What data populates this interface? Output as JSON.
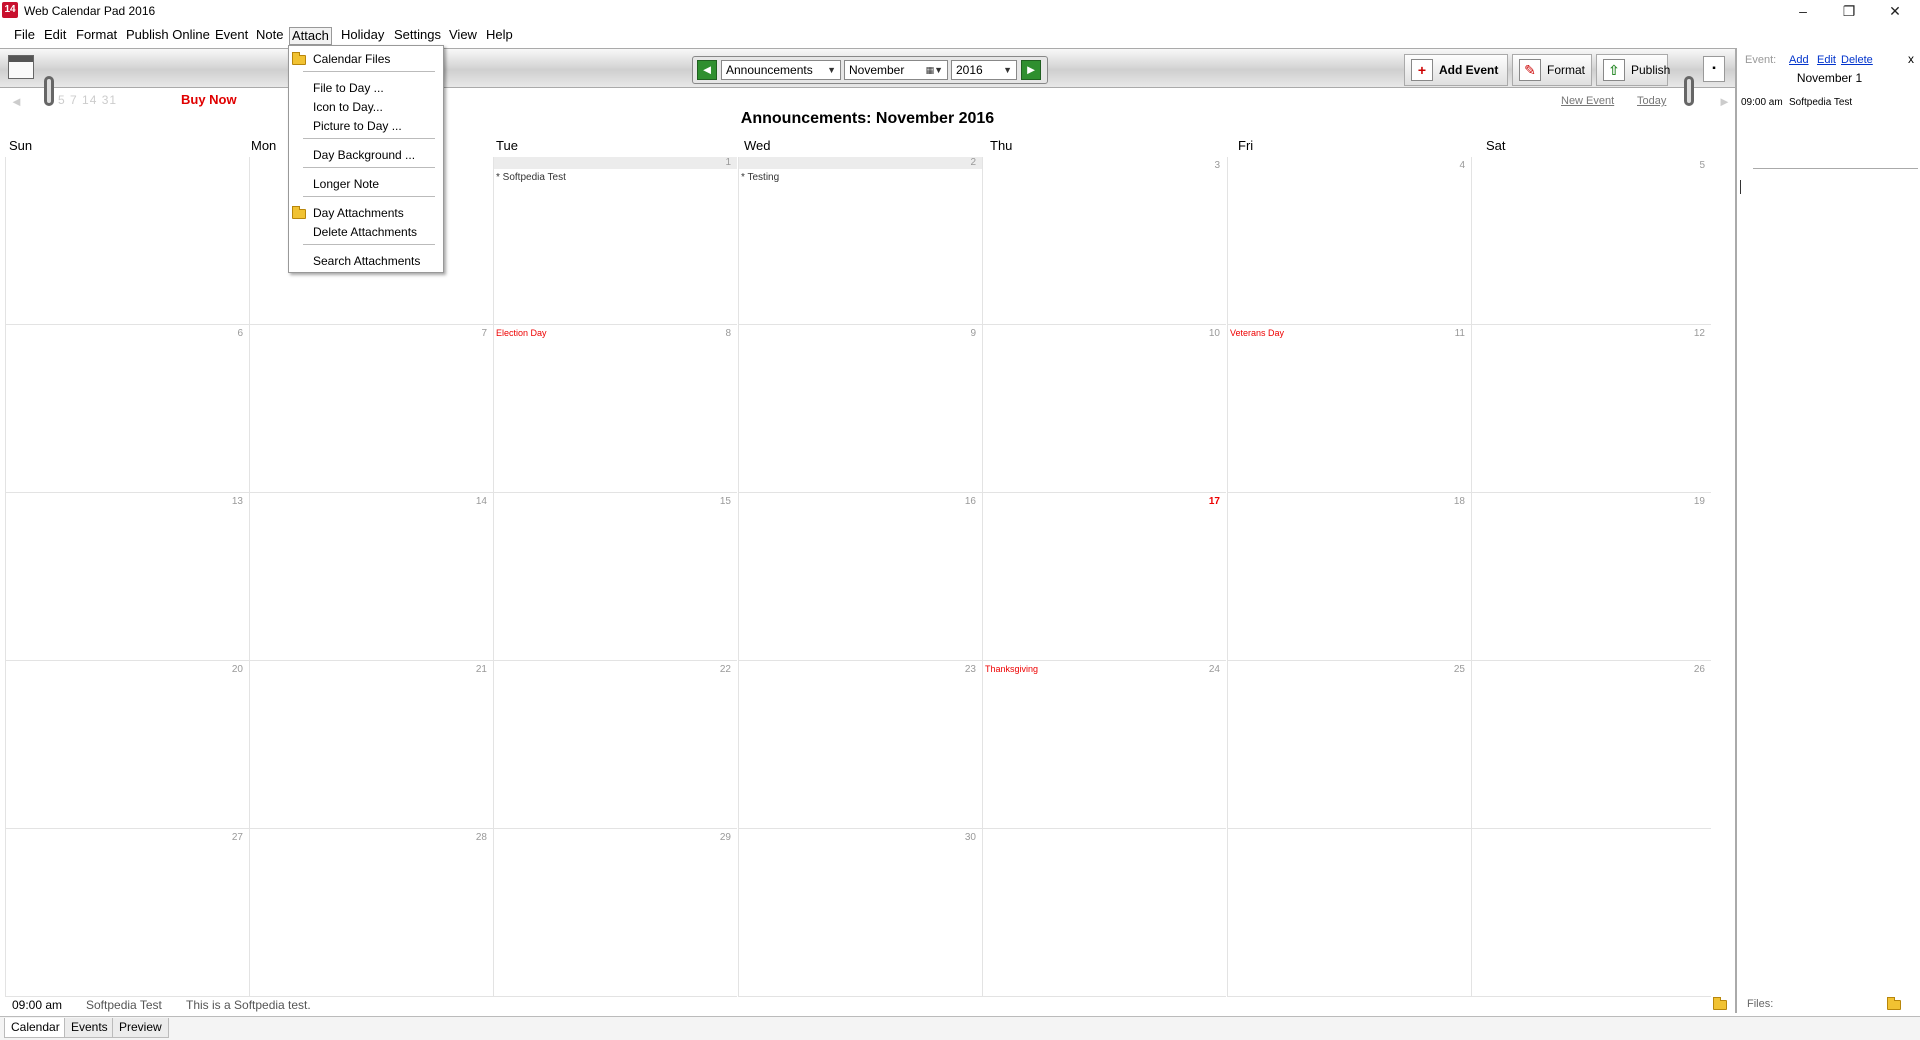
{
  "window": {
    "title": "Web Calendar Pad 2016",
    "icon_label": "14",
    "minimize": "–",
    "restore": "❐",
    "close": "✕"
  },
  "menu": [
    "File",
    "Edit",
    "Format",
    "Publish Online",
    "Event",
    "Note",
    "Attach",
    "Holiday",
    "Settings",
    "View",
    "Help"
  ],
  "attach_menu": {
    "items": [
      "Calendar Files",
      "File to Day ...",
      "Icon to Day...",
      "Picture to Day ...",
      "Day Background ...",
      "Longer Note",
      "Day Attachments",
      "Delete Attachments",
      "Search Attachments"
    ]
  },
  "toolbar": {
    "calendar_select": "Announcements",
    "month_select": "November",
    "year_select": "2016",
    "prev_arrow": "◄",
    "next_arrow": "►",
    "add_event_label": "Add Event",
    "add_event_icon": "+",
    "format_label": "Format",
    "publish_label": "Publish",
    "small_btn": "▪"
  },
  "subbar": {
    "mini_days": "5  7 14  31",
    "buy_now": "Buy Now",
    "new_event": "New Event",
    "today": "Today",
    "left_arrow": "◄",
    "right_arrow": "►"
  },
  "calendar": {
    "title": "Announcements:  November 2016",
    "weekdays": [
      "Sun",
      "Mon",
      "Tue",
      "Wed",
      "Thu",
      "Fri",
      "Sat"
    ],
    "weeks": [
      [
        "",
        "",
        "1",
        "2",
        "3",
        "4",
        "5"
      ],
      [
        "6",
        "7",
        "8",
        "9",
        "10",
        "11",
        "12"
      ],
      [
        "13",
        "14",
        "15",
        "16",
        "17",
        "18",
        "19"
      ],
      [
        "20",
        "21",
        "22",
        "23",
        "24",
        "25",
        "26"
      ],
      [
        "27",
        "28",
        "29",
        "30",
        "",
        "",
        ""
      ]
    ],
    "events": {
      "1": "* Softpedia Test",
      "2": "* Testing"
    },
    "holidays": {
      "8": "Election Day",
      "11": "Veterans Day",
      "24": "Thanksgiving"
    },
    "today": "17",
    "highlight_color": "#e00000"
  },
  "right_panel": {
    "event_label": "Event:",
    "add": "Add",
    "edit": "Edit",
    "delete": "Delete",
    "close": "x",
    "date": "November 1",
    "time": "09:00 am",
    "event": "Softpedia Test",
    "files_label": "Files:"
  },
  "status": {
    "time": "09:00 am",
    "event": "Softpedia Test",
    "note": "This is a Softpedia test."
  },
  "tabs": [
    "Calendar",
    "Events",
    "Preview"
  ]
}
